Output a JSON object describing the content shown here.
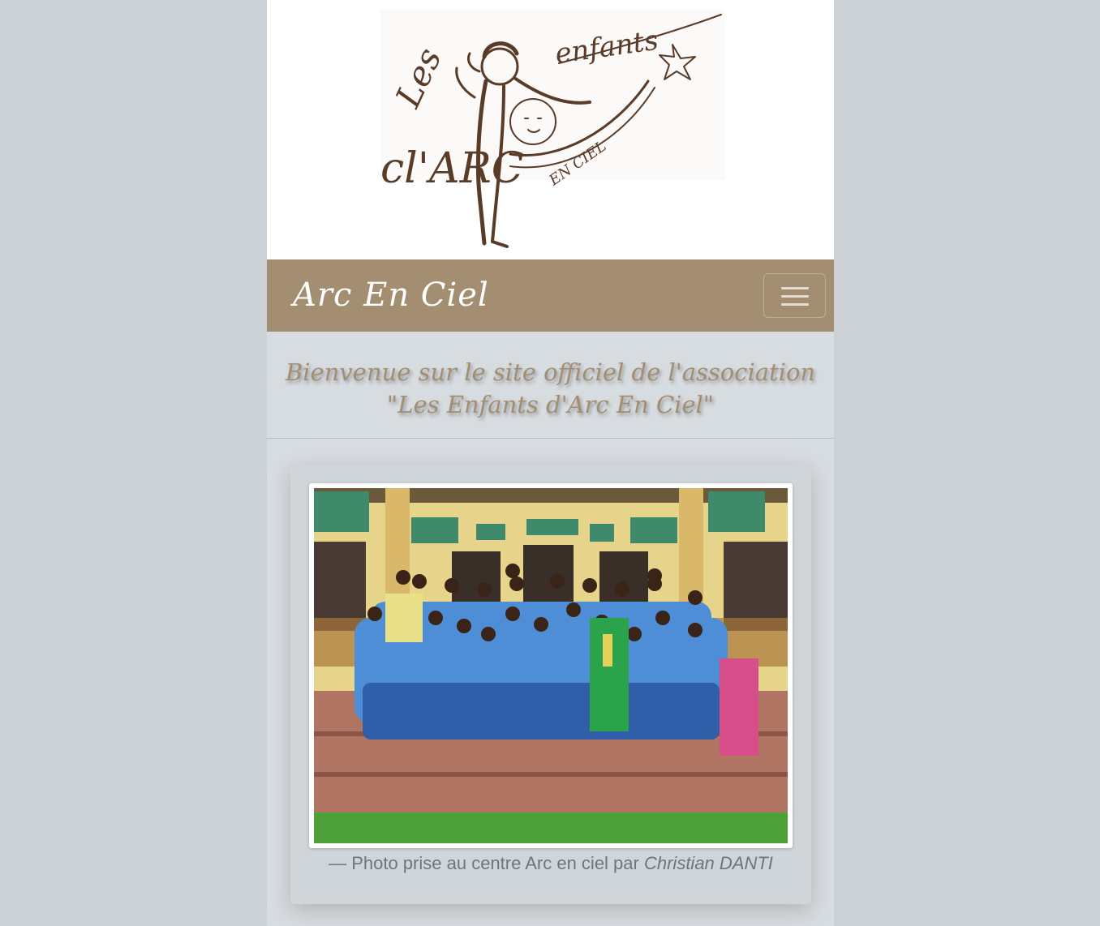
{
  "header": {
    "logo": {
      "text": "Les enfants d'ARC EN CIEL",
      "icon": "child-rainbow-star-logo"
    }
  },
  "navbar": {
    "brand": "Arc En Ciel",
    "toggler_icon": "hamburger-menu-icon"
  },
  "welcome": {
    "line1": "Bienvenue sur le site officiel de l'association",
    "line2": "\"Les Enfants d'Arc En Ciel\""
  },
  "photo": {
    "subject": "group-photo-children-blue-uniforms",
    "caption_prefix": "— Photo prise au centre Arc en ciel par",
    "caption_author": "Christian DANTI"
  },
  "colors": {
    "page_background": "#ccd1d5",
    "navbar": "#a38e71",
    "content_background": "#d7dce0",
    "welcome_text": "#a38e71",
    "caption_text": "#6e757c"
  }
}
